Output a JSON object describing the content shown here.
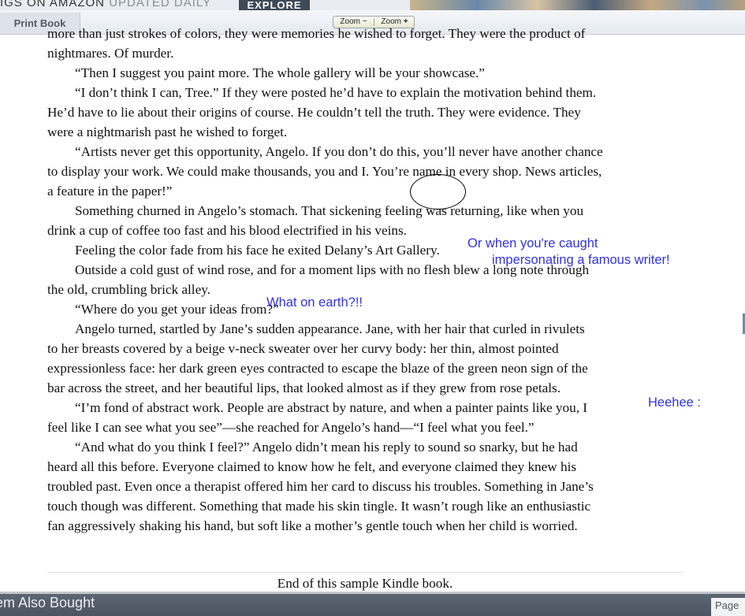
{
  "banner": {
    "left_text": "IGS ON AMAZON",
    "dim_text": "UPDATED DAILY",
    "explore_label": "EXPLORE"
  },
  "toolbar": {
    "tab_label": "Print Book",
    "zoom_out_label": "Zoom",
    "zoom_in_label": "Zoom"
  },
  "book": {
    "lines": [
      "more than just strokes of colors, they were memories he wished to forget. They were the product of",
      "nightmares. Of murder.",
      "“Then I suggest you paint more. The whole gallery will be your showcase.”",
      "“I don’t think I can, Tree.” If they were posted he’d have to explain the motivation behind them.",
      "He’d have to lie about their origins of course. He couldn’t tell the truth. They were evidence. They",
      "were a nightmarish past he wished to forget.",
      "“Artists never get this opportunity, Angelo. If you don’t do this, you’ll never have another chance",
      "to display your work. We could make thousands, you and I. You’re name in every shop. News articles,",
      "a feature in the paper!”",
      "Something churned in Angelo’s stomach. That sickening feeling was returning, like when you",
      "drink a cup of coffee too fast and his blood electrified in his veins.",
      "Feeling the color fade from his face he exited Delany’s Art Gallery.",
      "Outside a cold gust of wind rose, and for a moment lips with no flesh blew a long note through",
      "the old, crumbling brick alley.",
      "“Where do you get your ideas from?”",
      "Angelo turned, startled by Jane’s sudden appearance. Jane, with her hair that curled in rivulets",
      "to her breasts covered by a beige v-neck sweater over her curvy body: her thin, almost pointed",
      "expressionless face: her dark green eyes contracted to escape the blaze of the green neon sign of the",
      "bar across the street, and her beautiful lips, that looked almost as if they grew from rose petals.",
      "“I’m fond of abstract work. People are abstract by nature, and when a painter paints like you, I",
      "feel like I can see what you see”—she reached for Angelo’s hand—“I feel what you feel.”",
      "“And what do you think I feel?” Angelo didn’t mean his reply to sound so snarky, but he had",
      "heard all this before. Everyone claimed to know how he felt, and everyone claimed they knew his",
      "troubled past. Even once a therapist offered him her card to discuss his troubles. Something in Jane’s",
      "touch though was different. Something that made his skin tingle. It wasn’t rough like an enthusiastic",
      "fan aggressively shaking his hand, but soft like a mother’s gentle touch when her child is worried."
    ],
    "end_text": "End of this sample Kindle book."
  },
  "annotations": {
    "note1_line1": "Or when you're caught",
    "note1_line2": "impersonating a famous writer!",
    "note2": "What on earth?!!",
    "note3": "Heehee :"
  },
  "bottom": {
    "section_title": "em Also Bought",
    "page_label": "Page"
  }
}
